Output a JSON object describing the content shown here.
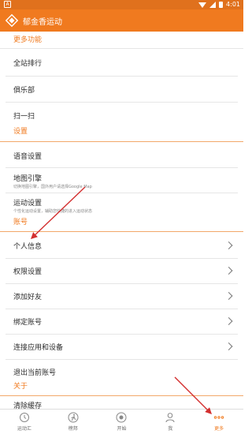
{
  "status_bar": {
    "left_icon": "A",
    "time": "4:01"
  },
  "app_bar": {
    "title": "郁金香运动"
  },
  "sections": {
    "more": {
      "title": "更多功能"
    },
    "settings": {
      "title": "设置"
    },
    "account": {
      "title": "账号"
    },
    "about": {
      "title": "关于"
    }
  },
  "rows": {
    "leaderboard": "全站排行",
    "club": "俱乐部",
    "scan": "扫一扫",
    "voice": "语音设置",
    "map_engine": "地图引擎",
    "map_engine_sub": "切换地图引擎，国外用户请选择Google Map",
    "sport_settings": "运动设置",
    "sport_settings_sub": "个性化运动设置，辅助您快捷的进入运动状态",
    "profile": "个人信息",
    "permissions": "权限设置",
    "add_friend": "添加好友",
    "bind_account": "绑定账号",
    "connect_apps": "连接应用和设备",
    "logout": "退出当前账号",
    "partial": "清除缓存"
  },
  "tabs": [
    {
      "label": "运动汇",
      "icon": "clock-icon"
    },
    {
      "label": "榜邦",
      "icon": "runner-icon"
    },
    {
      "label": "开始",
      "icon": "start-icon"
    },
    {
      "label": "我",
      "icon": "person-icon"
    },
    {
      "label": "更多",
      "icon": "more-dots-icon"
    }
  ],
  "colors": {
    "accent": "#f07a1f",
    "status_bar": "#e0711d",
    "arrow": "#d32f2f"
  }
}
